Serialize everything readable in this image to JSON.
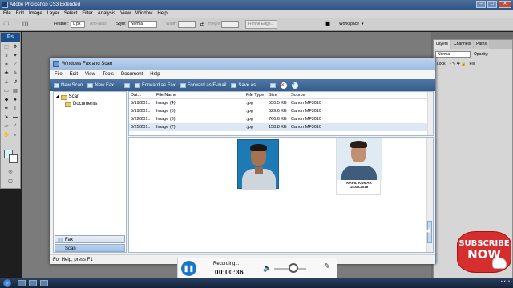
{
  "photoshop": {
    "title": "Adobe Photoshop CS3 Extended",
    "menu": [
      "File",
      "Edit",
      "Image",
      "Layer",
      "Select",
      "Filter",
      "Analysis",
      "View",
      "Window",
      "Help"
    ],
    "options": {
      "feather_label": "Feather:",
      "feather_value": "0 px",
      "anti_alias_label": "Anti-alias",
      "style_label": "Style:",
      "style_value": "Normal",
      "width_label": "Width:",
      "height_label": "Height:",
      "refine_edge_label": "Refine Edge...",
      "workspace_label": "Workspace"
    },
    "tools_badge": "Ps",
    "layers_panel": {
      "tabs": [
        "Layers",
        "Channels",
        "Paths"
      ],
      "blend_mode": "Normal",
      "opacity_label": "Opacity:",
      "lock_label": "Lock:",
      "fill_label": "Fill:"
    }
  },
  "fax_window": {
    "title": "Windows Fax and Scan",
    "menu": [
      "File",
      "Edit",
      "View",
      "Tools",
      "Document",
      "Help"
    ],
    "toolbar": {
      "new_scan": "New Scan",
      "new_fax": "New Fax",
      "forward_as_fax": "Forward as Fax",
      "forward_as_email": "Forward as E-mail",
      "save_as": "Save as..."
    },
    "tree": {
      "root": "Scan",
      "child": "Documents"
    },
    "nav_buttons": {
      "fax": "Fax",
      "scan": "Scan"
    },
    "list": {
      "columns": [
        "Dat...",
        "File Name",
        "File Type",
        "Size",
        "Source"
      ],
      "rows": [
        [
          "5/19/201...",
          "Image (4)",
          ".jpg",
          "550.5 KB",
          "Canon MF3010"
        ],
        [
          "5/19/201...",
          "Image (5)",
          ".jpg",
          "629.6 KB",
          "Canon MF3010"
        ],
        [
          "5/22/201...",
          "Image (6)",
          ".jpg",
          "766.6 KB",
          "Canon MF3010"
        ],
        [
          "6/25/201...",
          "Image (7)",
          ".jpg",
          "158.8 KB",
          "Canon MF3010"
        ]
      ],
      "selected_row": 3
    },
    "preview": {
      "caption_line1": "KAPIL KUMAR",
      "caption_line2": "18.05.2018"
    },
    "status_text": "For Help, press F1"
  },
  "recorder": {
    "status": "Recording...",
    "timer": "00:00:36",
    "pause_icon": "pause-icon",
    "volume_icon": "speaker-icon",
    "pen_icon": "pen-icon"
  },
  "overlay": {
    "subscribe_line1": "SUBSCRIBE",
    "subscribe_line2": "NOW"
  },
  "colors": {
    "fax_toolbar": "#3f6797",
    "subscribe_red": "#d62e2e",
    "recorder_button": "#1976c7"
  }
}
